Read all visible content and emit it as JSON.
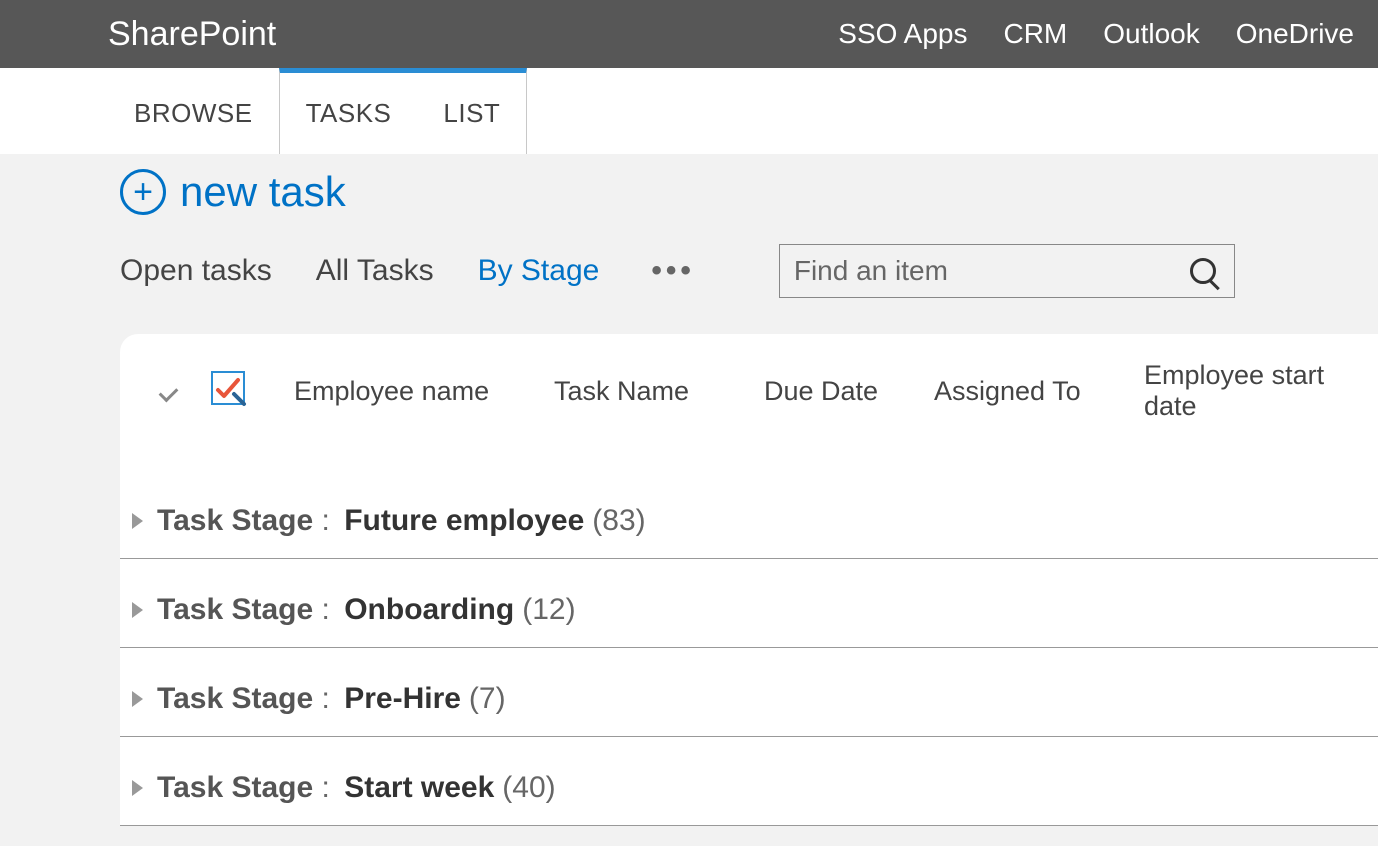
{
  "suite": {
    "title": "SharePoint",
    "links": [
      "SSO Apps",
      "CRM",
      "Outlook",
      "OneDrive"
    ]
  },
  "ribbon": {
    "tabs": [
      {
        "label": "BROWSE",
        "active": false
      },
      {
        "label": "TASKS",
        "active": true
      },
      {
        "label": "LIST",
        "active": true
      }
    ]
  },
  "newTask": {
    "label": "new task"
  },
  "views": {
    "items": [
      {
        "label": "Open tasks",
        "active": false
      },
      {
        "label": "All Tasks",
        "active": false
      },
      {
        "label": "By Stage",
        "active": true
      }
    ]
  },
  "search": {
    "placeholder": "Find an item"
  },
  "columns": {
    "employeeName": "Employee name",
    "taskName": "Task Name",
    "dueDate": "Due Date",
    "assignedTo": "Assigned To",
    "employeeStartDate": "Employee start date"
  },
  "groupLabelKey": "Task Stage",
  "groups": [
    {
      "value": "Future employee",
      "count": 83
    },
    {
      "value": "Onboarding",
      "count": 12
    },
    {
      "value": "Pre-Hire",
      "count": 7
    },
    {
      "value": "Start week",
      "count": 40
    }
  ]
}
